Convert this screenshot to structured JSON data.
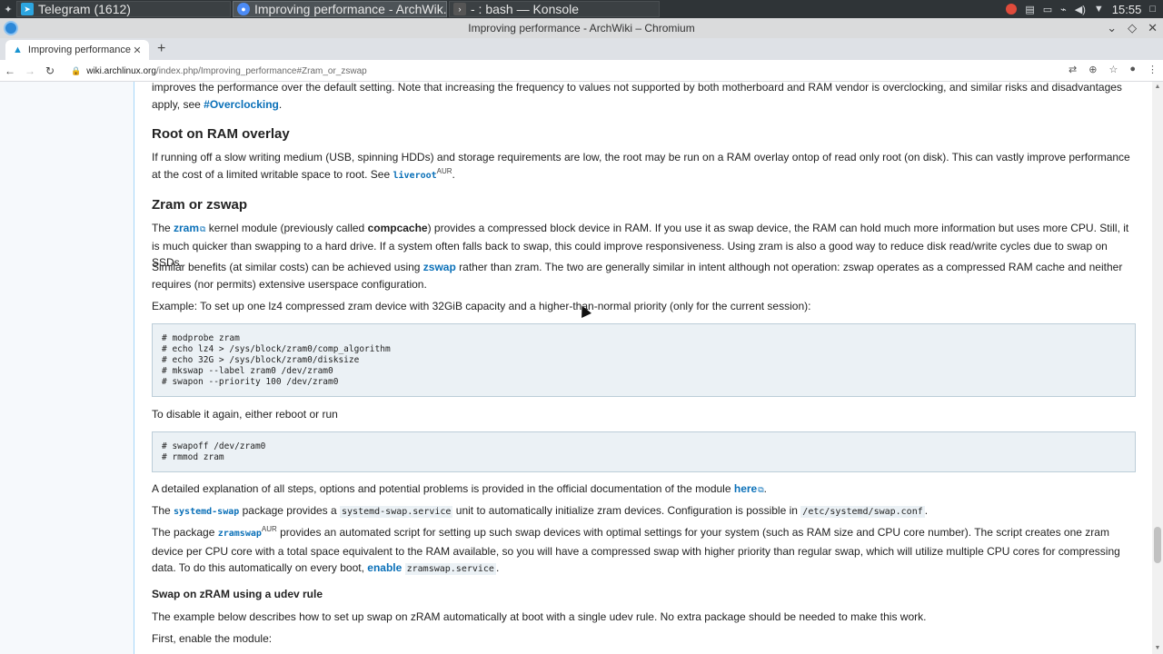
{
  "taskbar": {
    "tasks": [
      {
        "label": "Telegram (1612)",
        "icon": "telegram-icon",
        "color": "#2ca5e0"
      },
      {
        "label": "Improving performance - ArchWik...",
        "icon": "chromium-icon",
        "color": "#4c8bf5"
      },
      {
        "label": "- : bash — Konsole",
        "icon": "terminal-icon",
        "color": "#555555"
      }
    ],
    "clock": "15:55"
  },
  "window": {
    "title": "Improving performance - ArchWiki – Chromium"
  },
  "browser": {
    "tab_title": "Improving performance -",
    "url_host": "wiki.archlinux.org",
    "url_path": "/index.php/Improving_performance#Zram_or_zswap"
  },
  "article": {
    "intro_text": "improves the performance over the default setting. Note that increasing the frequency to values not supported by both motherboard and RAM vendor is overclocking, and similar risks and disadvantages apply, see ",
    "intro_link": "#Overclocking",
    "intro_end": ".",
    "h_root": "Root on RAM overlay",
    "root_text": "If running off a slow writing medium (USB, spinning HDDs) and storage requirements are low, the root may be run on a RAM overlay ontop of read only root (on disk). This can vastly improve performance at the cost of a limited writable space to root. See ",
    "root_link": "liveroot",
    "root_sup": "AUR",
    "root_end": ".",
    "h_zram": "Zram or zswap",
    "zram_p1_a": "The ",
    "zram_p1_link": "zram",
    "zram_p1_b": " kernel module (previously called ",
    "zram_p1_bold": "compcache",
    "zram_p1_c": ") provides a compressed block device in RAM. If you use it as swap device, the RAM can hold much more information but uses more CPU. Still, it is much quicker than swapping to a hard drive. If a system often falls back to swap, this could improve responsiveness. Using zram is also a good way to reduce disk read/write cycles due to swap on SSDs.",
    "zram_p2_a": "Similar benefits (at similar costs) can be achieved using ",
    "zram_p2_link": "zswap",
    "zram_p2_b": " rather than zram. The two are generally similar in intent although not operation: zswap operates as a compressed RAM cache and neither requires (nor permits) extensive userspace configuration.",
    "zram_p3": "Example: To set up one lz4 compressed zram device with 32GiB capacity and a higher-than-normal priority (only for the current session):",
    "code1": "# modprobe zram\n# echo lz4 > /sys/block/zram0/comp_algorithm\n# echo 32G > /sys/block/zram0/disksize\n# mkswap --label zram0 /dev/zram0\n# swapon --priority 100 /dev/zram0",
    "zram_p4": "To disable it again, either reboot or run",
    "code2": "# swapoff /dev/zram0\n# rmmod zram",
    "zram_p5_a": "A detailed explanation of all steps, options and potential problems is provided in the official documentation of the module ",
    "zram_p5_link": "here",
    "zram_p5_end": ".",
    "zram_p6_a": "The ",
    "zram_p6_link": "systemd-swap",
    "zram_p6_b": " package provides a ",
    "zram_p6_code1": "systemd-swap.service",
    "zram_p6_c": " unit to automatically initialize zram devices. Configuration is possible in ",
    "zram_p6_code2": "/etc/systemd/swap.conf",
    "zram_p6_end": ".",
    "zram_p7_a": "The package ",
    "zram_p7_link": "zramswap",
    "zram_p7_sup": "AUR",
    "zram_p7_b": " provides an automated script for setting up such swap devices with optimal settings for your system (such as RAM size and CPU core number). The script creates one zram device per CPU core with a total space equivalent to the RAM available, so you will have a compressed swap with higher priority than regular swap, which will utilize multiple CPU cores for compressing data. To do this automatically on every boot, ",
    "zram_p7_link2": "enable",
    "zram_p7_code": "zramswap.service",
    "zram_p7_end": ".",
    "h_udev": "Swap on zRAM using a udev rule",
    "udev_p1": "The example below describes how to set up swap on zRAM automatically at boot with a single udev rule. No extra package should be needed to make this work.",
    "udev_p2": "First, enable the module:"
  }
}
